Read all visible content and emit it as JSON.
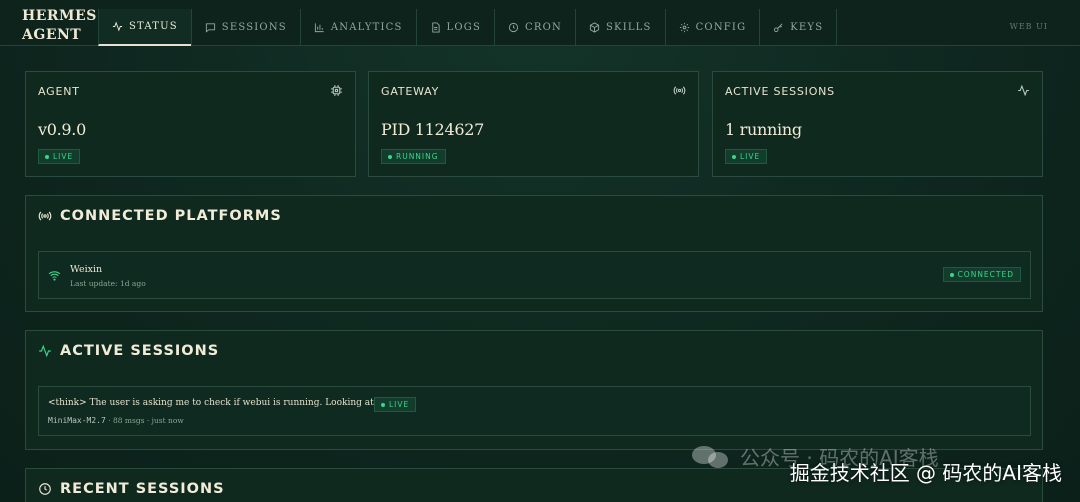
{
  "brand": {
    "line1": "HERMES",
    "line2": "AGENT"
  },
  "nav": {
    "tabs": [
      {
        "label": "STATUS",
        "icon": "activity-icon",
        "active": true
      },
      {
        "label": "SESSIONS",
        "icon": "message-icon"
      },
      {
        "label": "ANALYTICS",
        "icon": "bar-chart-icon"
      },
      {
        "label": "LOGS",
        "icon": "file-icon"
      },
      {
        "label": "CRON",
        "icon": "clock-icon"
      },
      {
        "label": "SKILLS",
        "icon": "package-icon"
      },
      {
        "label": "CONFIG",
        "icon": "gear-icon"
      },
      {
        "label": "KEYS",
        "icon": "key-icon"
      }
    ],
    "right_label": "WEB UI"
  },
  "stats": {
    "agent": {
      "title": "AGENT",
      "value": "v0.9.0",
      "badge": "LIVE",
      "icon": "chip-icon"
    },
    "gateway": {
      "title": "GATEWAY",
      "value": "PID 1124627",
      "badge": "RUNNING",
      "icon": "radio-icon"
    },
    "active": {
      "title": "ACTIVE SESSIONS",
      "value": "1 running",
      "badge": "LIVE",
      "icon": "activity-icon"
    }
  },
  "platforms": {
    "title": "CONNECTED PLATFORMS",
    "items": [
      {
        "name": "Weixin",
        "sub": "Last update: 1d ago",
        "badge": "CONNECTED",
        "icon": "wifi-icon"
      }
    ]
  },
  "active_sessions": {
    "title": "ACTIVE SESSIONS",
    "items": [
      {
        "text": "<think> The user is asking me to check if webui is running. Looking at the as...",
        "badge": "LIVE",
        "model": "MiniMax-M2.7",
        "meta": "· 88 msgs · just now"
      }
    ]
  },
  "recent_sessions": {
    "title": "RECENT SESSIONS"
  },
  "watermark": {
    "main": "掘金技术社区 @ 码农的AI客栈",
    "faint": "公众号 · 码农的AI客栈"
  },
  "colors": {
    "accent_green": "#3fd38a",
    "background": "#0f2a22",
    "card": "#10291f",
    "border": "#2a4b3e"
  }
}
